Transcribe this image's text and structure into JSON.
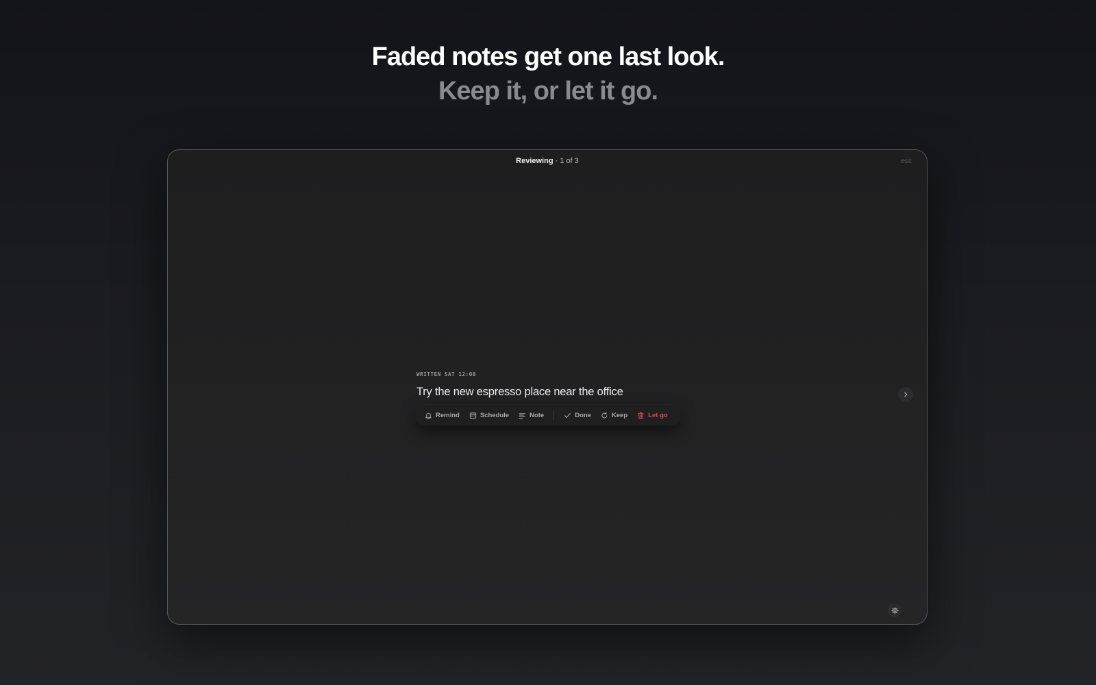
{
  "hero": {
    "line1": "Faded notes get one last look.",
    "line2": "Keep it, or let it go."
  },
  "window": {
    "title_strong": "Reviewing",
    "title_rest": " · 1 of 3",
    "esc_label": "esc"
  },
  "note": {
    "meta": "WRITTEN SAT 12:00",
    "text": "Try the new espresso place near the office"
  },
  "toolbar": {
    "remind": "Remind",
    "schedule": "Schedule",
    "note": "Note",
    "done": "Done",
    "keep": "Keep",
    "let_go": "Let go"
  },
  "icons": {
    "remind": "bell-icon",
    "schedule": "calendar-icon",
    "note": "lines-icon",
    "done": "check-icon",
    "keep": "rotate-icon",
    "let_go": "trash-icon",
    "next": "chevron-right-icon",
    "settings": "gear-icon"
  },
  "colors": {
    "danger": "#e8484d",
    "text_muted": "#a9a9ad",
    "headline_secondary": "#8a8a8e"
  }
}
